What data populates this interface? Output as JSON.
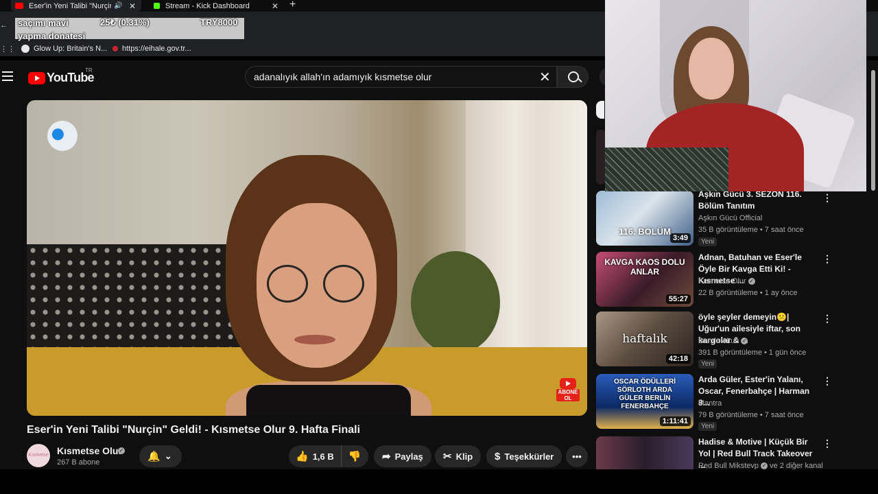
{
  "browser": {
    "tabs": [
      {
        "title": "Eser'in Yeni Talibi \"Nurçin\" G",
        "active": true,
        "favicon_color": "#ff0000"
      },
      {
        "title": "Stream - Kick Dashboard",
        "active": false,
        "favicon_color": "#53fc18"
      }
    ],
    "new_tab_glyph": "+",
    "close_glyph": "✕",
    "speaker_glyph": "🔊",
    "bookmarks": [
      {
        "label": "Glow Up: Britain's N...",
        "icon_color": "#e8e8e8"
      },
      {
        "label": "https://eihale.gov.tr...",
        "icon_color": "#c62828"
      }
    ]
  },
  "donation_overlay": {
    "line1_left": "saçımı mavi",
    "amount": "25₺ (0.31%)",
    "total": "TRY8000",
    "line2": "yapma donatesi"
  },
  "youtube": {
    "logo_word": "YouTube",
    "country_code": "TR",
    "search_query": "adanalıyık allah'ın adamıyık kısmetse olur",
    "clear_glyph": "✕",
    "video": {
      "title": "Eser'in Yeni Talibi \"Nurçin\" Geldi! - Kısmetse Olur 9. Hafta Finali",
      "subscribe_badge_text": "ABONE OL"
    },
    "owner": {
      "name": "Kısmetse Olur",
      "subscribers": "267 B abone",
      "avatar_text": "Kısmetse Olur",
      "verified_glyph": "✓"
    },
    "actions": {
      "bell_glyph": "🔔",
      "bell_chevron": "⌄",
      "like_glyph": "👍",
      "like_count": "1,6 B",
      "dislike_glyph": "👎",
      "share": "Paylaş",
      "share_glyph": "➦",
      "clip": "Klip",
      "clip_glyph": "✂",
      "thanks": "Teşekkürler",
      "thanks_glyph": "$",
      "more_glyph": "•••"
    },
    "recommendations": [
      {
        "title": "Aşkın Gücü 3. SEZON 116. Bölüm Tanıtım",
        "channel": "Aşkın Gücü Official",
        "verified": false,
        "meta": "35 B görüntüleme • 7 saat önce",
        "badge": "Yeni",
        "duration": "3:49",
        "thumb_text": "116. BÖLÜM",
        "thumb_colors": [
          "#7fa7c9",
          "#2b4b7a"
        ]
      },
      {
        "title": "Adnan, Batuhan ve Eser'le Öyle Bir Kavga Etti Ki! - Kısmetse ...",
        "channel": "Kısmetse Olur",
        "verified": true,
        "meta": "22 B görüntüleme • 1 ay önce",
        "badge": "",
        "duration": "55:27",
        "thumb_text": "KAVGA KAOS DOLU ANLAR",
        "thumb_colors": [
          "#6b2b3d",
          "#2a1a22"
        ]
      },
      {
        "title": "öyle şeyler demeyin😕| Uğur'un ailesiyle iftar, son kargolar & ...",
        "channel": "Damla Altun",
        "verified": true,
        "meta": "391 B görüntüleme • 1 gün önce",
        "badge": "Yeni",
        "duration": "42:18",
        "thumb_text": "haftalık",
        "thumb_colors": [
          "#8d7a6a",
          "#3b302a"
        ]
      },
      {
        "title": "Arda Güler, Ester'in Yalanı, Oscar, Fenerbahçe | Harman 8...",
        "channel": "Mantra",
        "verified": false,
        "meta": "79 B görüntüleme • 7 saat önce",
        "badge": "Yeni",
        "duration": "1:11:41",
        "thumb_text": "OSCAR ÖDÜLLERİ SÖRLOTH ARDA GÜLER BERLİN FENERBAHÇE",
        "thumb_colors": [
          "#1e4fa3",
          "#0b2155"
        ]
      },
      {
        "title": "Hadise & Motive | Küçük Bir Yol | Red Bull Track Takeover ...",
        "channel": "Red Bull Mikstevp",
        "verified": true,
        "channel_suffix": "ve 2 diğer kanal",
        "meta": "",
        "badge": "",
        "duration": "",
        "thumb_text": "",
        "thumb_colors": [
          "#4a2c3a",
          "#1e1a2a"
        ]
      }
    ],
    "kebab_glyph": "⋮"
  }
}
